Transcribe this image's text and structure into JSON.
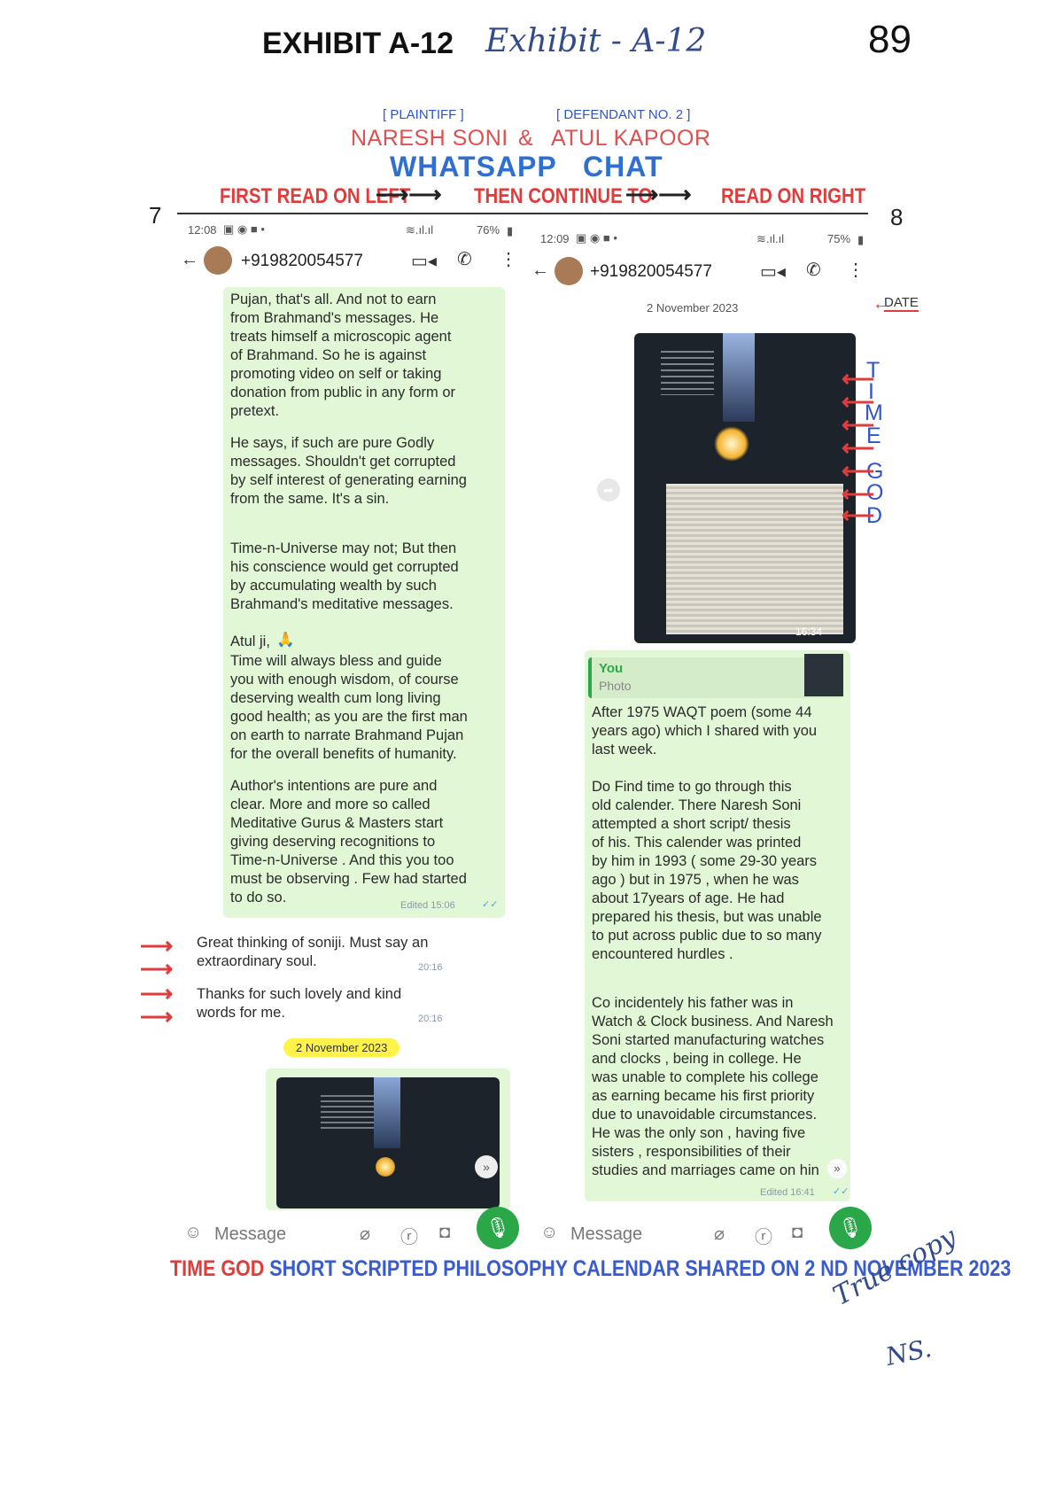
{
  "header": {
    "exhibit_label": "EXHIBIT A-12",
    "handwritten_label": "Exhibit - A-12",
    "page_number": "89",
    "plaintiff_role": "[ PLAINTIFF ]",
    "defendant_role": "[ DEFENDANT NO. 2 ]",
    "plaintiff_name": "NARESH SONI",
    "ampersand": "&",
    "defendant_name": "ATUL KAPOOR",
    "chat_title_1": "WHATSAPP",
    "chat_title_2": "CHAT",
    "read_left": "FIRST READ ON LEFT",
    "read_middle": "THEN CONTINUE TO",
    "read_right": "READ ON RIGHT",
    "side_left_number": "7",
    "side_right_number": "8"
  },
  "left_phone": {
    "status_time": "12:08",
    "battery": "76%",
    "contact": "+919820054577",
    "message_1": "Pujan, that's all. And not to earn\nfrom Brahmand's messages. He\ntreats himself a microscopic agent\nof Brahmand.  So he is against\npromoting  video on self or taking\ndonation from public in any form or\npretext.",
    "message_2": "He says,  if such are pure Godly\nmessages. Shouldn't get corrupted\nby self interest of generating earning\nfrom the same. It's a sin.",
    "message_3": "Time-n-Universe may not; But then\nhis conscience would get corrupted\nby accumulating wealth by such\nBrahmand's meditative messages.",
    "message_4_greeting": "Atul ji,",
    "message_4_emoji": "🙏",
    "message_4": "Time will always bless and guide\nyou with enough wisdom, of course\ndeserving wealth  cum long living\ngood health; as you are the first man\non earth to narrate Brahmand Pujan\nfor the overall benefits of humanity.",
    "message_5": "Author's intentions are pure and\nclear. More and more so called\nMeditative Gurus & Masters start\ngiving deserving recognitions to\nTime-n-Universe . And   this you too\nmust be observing . Few had started\nto do so.",
    "edited_meta": "Edited 15:06",
    "incoming_1": "Great thinking of soniji. Must say an\nextraordinary soul.",
    "incoming_1_time": "20:16",
    "incoming_2": "Thanks for such lovely and kind\nwords for me.",
    "incoming_2_time": "20:16",
    "date_chip": "2 November 2023",
    "input_placeholder": "Message"
  },
  "right_phone": {
    "status_time": "12:09",
    "battery": "75%",
    "contact": "+919820054577",
    "date_plain": "2 November 2023",
    "image_time": "16:34",
    "reply_sender": "You",
    "reply_type": "Photo",
    "message_1": "After 1975 WAQT poem (some 44\nyears ago)  which I shared with you\nlast week.",
    "message_2": "Do Find time to go through this\nold calender. There Naresh Soni\nattempted a short script/ thesis\nof his.  This  calender was printed\nby him in 1993 ( some 29-30 years\nago )  but in 1975 , when he was\nabout 17years of age. He had\nprepared his thesis, but was unable\nto put across public due to so many\nencountered hurdles .",
    "message_3": "Co incidentely his father was in\nWatch & Clock business. And Naresh\nSoni started manufacturing watches\nand clocks , being in college. He\nwas unable to complete his college\nas earning became his first priority\ndue to unavoidable circumstances.\nHe was the only son , having five\nsisters , responsibilities of their\nstudies and marriages came on hin",
    "edited_meta": "Edited 16:41",
    "input_placeholder": "Message"
  },
  "annotations": {
    "date_label": "DATE",
    "vertical_letters": [
      "T",
      "I",
      "M",
      "E",
      "G",
      "O",
      "D"
    ]
  },
  "footer": {
    "red_part": "TIME GOD",
    "blue_part": " SHORT SCRIPTED PHILOSOPHY CALENDAR SHARED ON  2 ND NOVEMBER 2023"
  },
  "handwriting": {
    "line_1": "True copy",
    "line_2": "NS."
  },
  "colors": {
    "bubble_green": "#e2f7d6",
    "annotation_red": "#e03c3c",
    "annotation_blue": "#2f55c8",
    "highlight_yellow": "#fff34a",
    "mic_green": "#2aa748"
  }
}
